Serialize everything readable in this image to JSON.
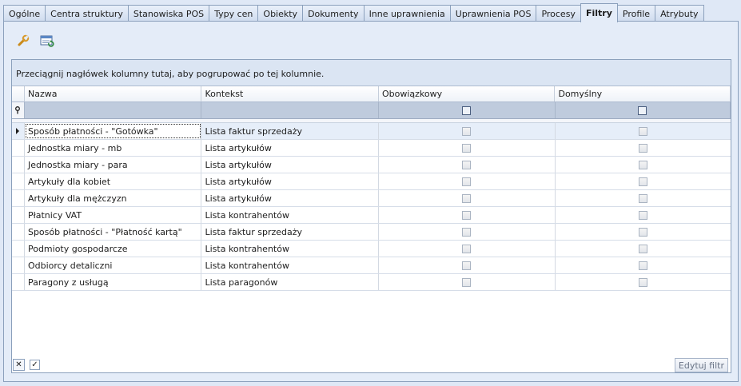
{
  "tabs": [
    {
      "label": "Ogólne",
      "active": false
    },
    {
      "label": "Centra struktury",
      "active": false
    },
    {
      "label": "Stanowiska POS",
      "active": false
    },
    {
      "label": "Typy cen",
      "active": false
    },
    {
      "label": "Obiekty",
      "active": false
    },
    {
      "label": "Dokumenty",
      "active": false
    },
    {
      "label": "Inne uprawnienia",
      "active": false
    },
    {
      "label": "Uprawnienia POS",
      "active": false
    },
    {
      "label": "Procesy",
      "active": false
    },
    {
      "label": "Filtry",
      "active": true
    },
    {
      "label": "Profile",
      "active": false
    },
    {
      "label": "Atrybuty",
      "active": false
    }
  ],
  "toolbar": {
    "icons": [
      "wrench-icon",
      "refresh-list-icon"
    ]
  },
  "grid": {
    "group_hint": "Przeciągnij nagłówek kolumny tutaj, aby pogrupować po tej kolumnie.",
    "columns": {
      "name": "Nazwa",
      "context": "Kontekst",
      "required": "Obowiązkowy",
      "default": "Domyślny"
    },
    "rows": [
      {
        "name": "Sposób płatności - \"Gotówka\"",
        "context": "Lista faktur sprzedaży",
        "required": false,
        "default": false,
        "selected": true
      },
      {
        "name": "Jednostka miary - mb",
        "context": "Lista artykułów",
        "required": false,
        "default": false
      },
      {
        "name": "Jednostka miary - para",
        "context": "Lista artykułów",
        "required": false,
        "default": false
      },
      {
        "name": "Artykuły dla kobiet",
        "context": "Lista artykułów",
        "required": false,
        "default": false
      },
      {
        "name": "Artykuły dla mężczyzn",
        "context": "Lista artykułów",
        "required": false,
        "default": false
      },
      {
        "name": "Płatnicy VAT",
        "context": "Lista kontrahentów",
        "required": false,
        "default": false
      },
      {
        "name": "Sposób płatności - \"Płatność kartą\"",
        "context": "Lista faktur sprzedaży",
        "required": false,
        "default": false
      },
      {
        "name": "Podmioty gospodarcze",
        "context": "Lista kontrahentów",
        "required": false,
        "default": false
      },
      {
        "name": "Odbiorcy detaliczni",
        "context": "Lista kontrahentów",
        "required": false,
        "default": false
      },
      {
        "name": "Paragony z usługą",
        "context": "Lista paragonów",
        "required": false,
        "default": false
      }
    ]
  },
  "footer": {
    "edit_filter_label": "Edytuj filtr",
    "clear_glyph": "✕",
    "check_glyph": "✓"
  },
  "colors": {
    "background": "#dfe8f6",
    "border": "#8ba0bc",
    "filter_row": "#bfcbdd"
  }
}
